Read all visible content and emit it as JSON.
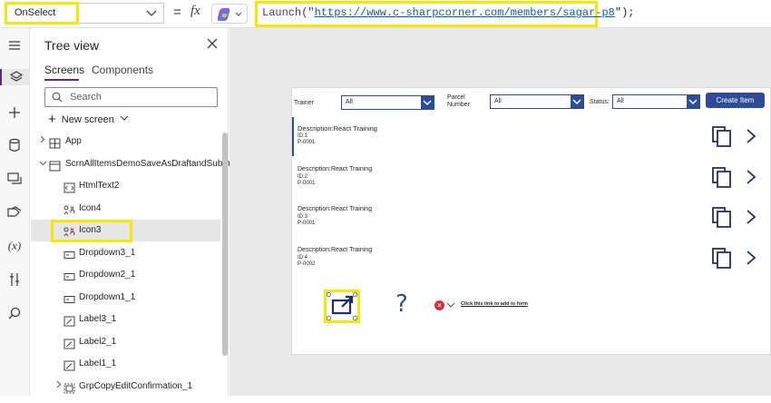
{
  "formula_bar": {
    "property": "OnSelect",
    "equals": "=",
    "fx": "fx",
    "formula_func": "Launch(\"",
    "formula_url": "https://www.c-sharpcorner.com/members/sagar-p8",
    "formula_end": "\");"
  },
  "rail": {
    "icons": [
      "hamburger-icon",
      "layers-icon",
      "plus-icon",
      "database-icon",
      "media-icon",
      "tags-icon",
      "variables-icon",
      "tools-icon",
      "search-icon"
    ],
    "active": "layers-icon"
  },
  "tree_view": {
    "title": "Tree view",
    "tabs": [
      "Screens",
      "Components"
    ],
    "selected_tab": "Screens",
    "search_placeholder": "Search",
    "new_screen": "New screen",
    "rows": [
      {
        "label": "App",
        "icon": "app-icon",
        "indent": 0,
        "caret": ">",
        "selected": false
      },
      {
        "label": "ScrnAllItemsDemoSaveAsDraftandSubmit",
        "icon": "screen-icon",
        "indent": 0,
        "caret": "v",
        "selected": false
      },
      {
        "label": "HtmlText2",
        "icon": "html-icon",
        "indent": 1,
        "caret": "",
        "selected": false
      },
      {
        "label": "Icon4",
        "icon": "icon-control-icon",
        "indent": 1,
        "caret": "",
        "selected": false
      },
      {
        "label": "Icon3",
        "icon": "icon-control-icon",
        "indent": 1,
        "caret": "",
        "selected": true
      },
      {
        "label": "Dropdown3_1",
        "icon": "dropdown-icon",
        "indent": 1,
        "caret": "",
        "selected": false
      },
      {
        "label": "Dropdown2_1",
        "icon": "dropdown-icon",
        "indent": 1,
        "caret": "",
        "selected": false
      },
      {
        "label": "Dropdown1_1",
        "icon": "dropdown-icon",
        "indent": 1,
        "caret": "",
        "selected": false
      },
      {
        "label": "Label3_1",
        "icon": "label-icon",
        "indent": 1,
        "caret": "",
        "selected": false
      },
      {
        "label": "Label2_1",
        "icon": "label-icon",
        "indent": 1,
        "caret": "",
        "selected": false
      },
      {
        "label": "Label1_1",
        "icon": "label-icon",
        "indent": 1,
        "caret": "",
        "selected": false
      },
      {
        "label": "GrpCopyEditConfirmation_1",
        "icon": "group-icon",
        "indent": 1,
        "caret": ">",
        "selected": false
      }
    ]
  },
  "app_screen": {
    "filters": [
      {
        "label": "Trainer",
        "value": "All"
      },
      {
        "label": "Parcel Number",
        "value": "All"
      },
      {
        "label": "Status:",
        "value": "All"
      }
    ],
    "create_button": "Create Item",
    "items": [
      {
        "description": "Description:React Training",
        "id": "ID:1",
        "p": "P-0001"
      },
      {
        "description": "Description:React Training",
        "id": "ID:2",
        "p": "P-0001"
      },
      {
        "description": "Description:React Training",
        "id": "ID:3",
        "p": "P-0001"
      },
      {
        "description": "Description:React Training",
        "id": "ID:4",
        "p": "P-0002"
      }
    ],
    "question_mark": "?",
    "error_glyph": "×",
    "link_text": "Click this link to add to form"
  },
  "colors": {
    "highlight": "#f5e70e",
    "accent": "#2f4c9a",
    "brand": "#5b2a86",
    "error": "#d22b3c"
  }
}
